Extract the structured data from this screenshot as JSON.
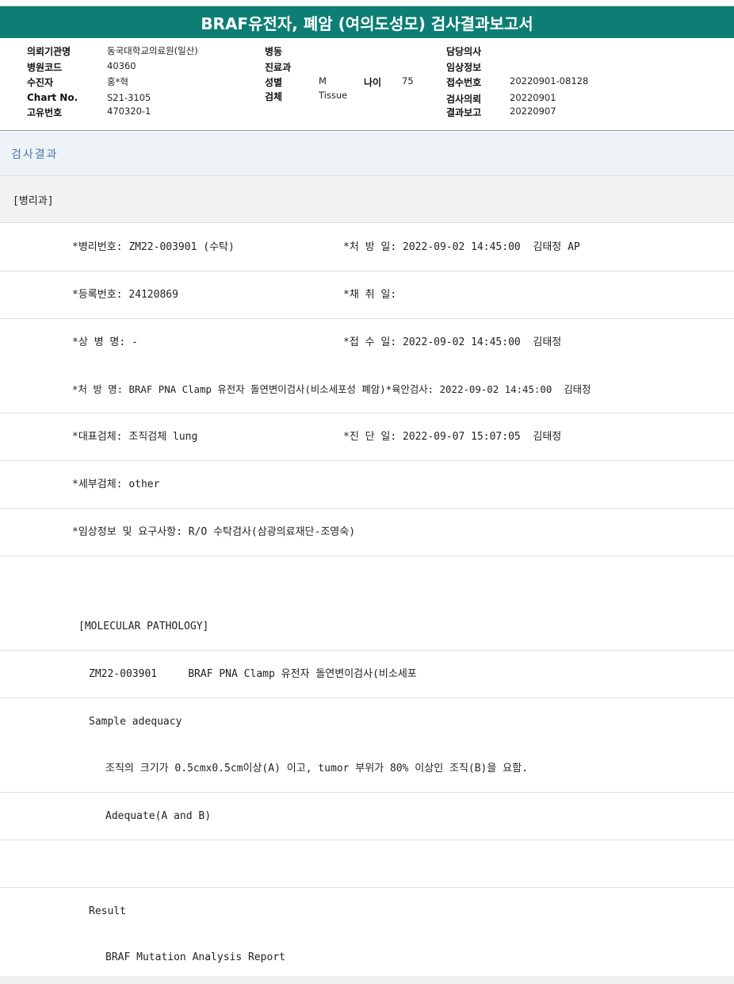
{
  "title": "BRAF유전자, 폐암 (여의도성모) 검사결과보고서",
  "header": {
    "col1": [
      {
        "label": "의뢰기관명",
        "value": "동국대학교의료원(일산)"
      },
      {
        "label": "병원코드",
        "value": "40360"
      },
      {
        "label": "수진자",
        "value": "홍*혁"
      },
      {
        "label": "Chart No.",
        "value": "S21-3105"
      },
      {
        "label": "고유번호",
        "value": "470320-1"
      }
    ],
    "col2": [
      {
        "label": "병동",
        "value": ""
      },
      {
        "label": "진료과",
        "value": ""
      },
      {
        "label": "성별",
        "value": "M"
      },
      {
        "label": "검체",
        "value": "Tissue"
      }
    ],
    "age": {
      "label": "나이",
      "value": "75"
    },
    "col3": [
      {
        "label": "담당의사",
        "value": ""
      },
      {
        "label": "임상정보",
        "value": ""
      },
      {
        "label": "접수번호",
        "value": "20220901-08128"
      },
      {
        "label": "검사의뢰",
        "value": "20220901"
      },
      {
        "label": "결과보고",
        "value": "20220907"
      }
    ]
  },
  "section_title": "검사결과",
  "department": "[병리과]",
  "rows": [
    {
      "left": "*병리번호: ZM22-003901 (수탁)",
      "right": "*처 방 일: 2022-09-02 14:45:00  김태정 AP"
    },
    {
      "left": "*등록번호: 24120869",
      "right": "*채 취 일:"
    },
    {
      "left": "*상 병 명: -",
      "right": "*접 수 일: 2022-09-02 14:45:00  김태정"
    },
    {
      "left": "*처 방 명: BRAF PNA Clamp 유전자 돌연변이검사(비소세포성 폐암)*육안검사: 2022-09-02 14:45:00  김태정",
      "right": ""
    },
    {
      "left": "*대표검체: 조직검체 lung",
      "right": "*진 단 일: 2022-09-07 15:07:05  김태정"
    },
    {
      "left": "*세부검체: other",
      "right": ""
    },
    {
      "left": "*임상정보 및 요구사항: R/O 수탁검사(삼광의료재단-조영숙)",
      "right": ""
    },
    {
      "left": "",
      "right": ""
    },
    {
      "left": "[MOLECULAR PATHOLOGY]",
      "right": ""
    },
    {
      "left": "ZM22-003901     BRAF PNA Clamp 유전자 돌연변이검사(비소세포",
      "right": ""
    },
    {
      "left": "Sample adequacy",
      "right": ""
    },
    {
      "left": "조직의 크기가 0.5cmx0.5cm이상(A) 이고, tumor 부위가 80% 이상인 조직(B)을 요함.",
      "right": ""
    },
    {
      "left": "Adequate(A and B)",
      "right": ""
    },
    {
      "left": "",
      "right": ""
    },
    {
      "left": "Result",
      "right": ""
    },
    {
      "left": "BRAF Mutation Analysis Report",
      "right": ""
    }
  ]
}
